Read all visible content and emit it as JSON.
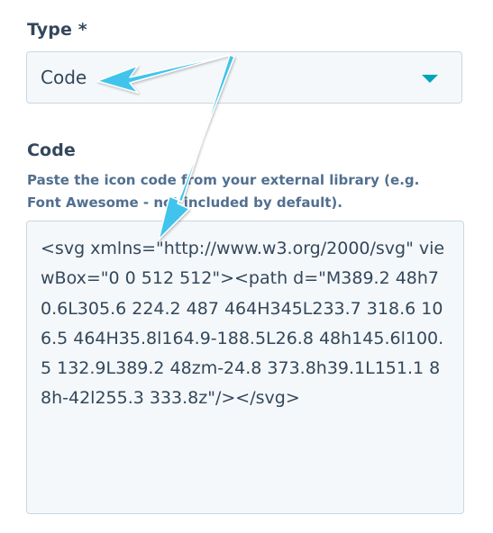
{
  "type_field": {
    "label": "Type *",
    "selected_value": "Code",
    "chevron_icon": "chevron-down-icon"
  },
  "code_field": {
    "label": "Code",
    "help_text": "Paste the icon code from your external library (e.g. Font Awesome - not included by default).",
    "value": "<svg xmlns=\"http://www.w3.org/2000/svg\" viewBox=\"0 0 512 512\"><path d=\"M389.2 48h70.6L305.6 224.2 487 464H345L233.7 318.6 106.5 464H35.8l164.9-188.5L26.8 48h145.6l100.5 132.9L389.2 48zm-24.8 373.8h39.1L151.1 88h-42l255.3 333.8z\"/></svg>"
  },
  "colors": {
    "text": "#33475b",
    "help_text": "#516f90",
    "field_background": "#f5f8fa",
    "field_border": "#cbd6e2",
    "accent": "#00a4bd",
    "annotation_arrow": "#3fc4ec"
  }
}
